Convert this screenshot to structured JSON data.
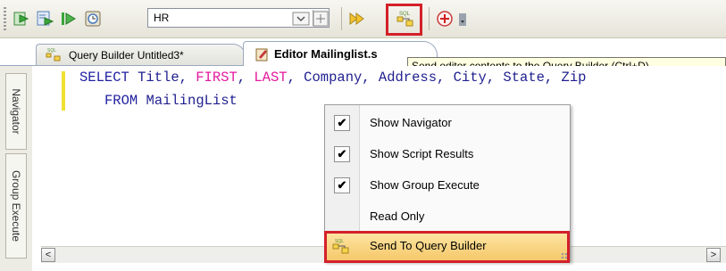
{
  "toolbar": {
    "connection_value": "HR",
    "icons": [
      "execute-statement-icon",
      "execute-script-icon",
      "step-into-icon",
      "history-icon",
      "find-icon",
      "run-icon",
      "send-to-query-builder-icon",
      "add-icon",
      "dropdown-icon"
    ]
  },
  "tabs": [
    {
      "label": "Query Builder Untitled3*",
      "active": false
    },
    {
      "label": "Editor Mailinglist.s",
      "active": true
    }
  ],
  "tooltip": "Send editor contents to the Query Builder (Ctrl+D)",
  "side_tabs": [
    "Navigator",
    "Group Execute"
  ],
  "code": {
    "line1": {
      "kw_select": "SELECT",
      "title": " Title, ",
      "first": "FIRST",
      "sep1": ", ",
      "last": "LAST",
      "rest": ", Company, Address, City, State, Zip"
    },
    "line2": {
      "kw_from": "FROM",
      "table": " MailingList"
    }
  },
  "context_menu": [
    {
      "label": "Show Navigator",
      "checked": true
    },
    {
      "label": "Show Script Results",
      "checked": true
    },
    {
      "label": "Show Group Execute",
      "checked": true
    },
    {
      "label": "Read Only",
      "checked": false
    },
    {
      "label": "Send To Query Builder",
      "checked": false,
      "highlighted": true
    }
  ],
  "colors": {
    "highlight_border": "#d4202a",
    "keyword": "#1f1fa0",
    "reserved_column": "#e3199c",
    "menu_hover": "#f6c86a"
  }
}
